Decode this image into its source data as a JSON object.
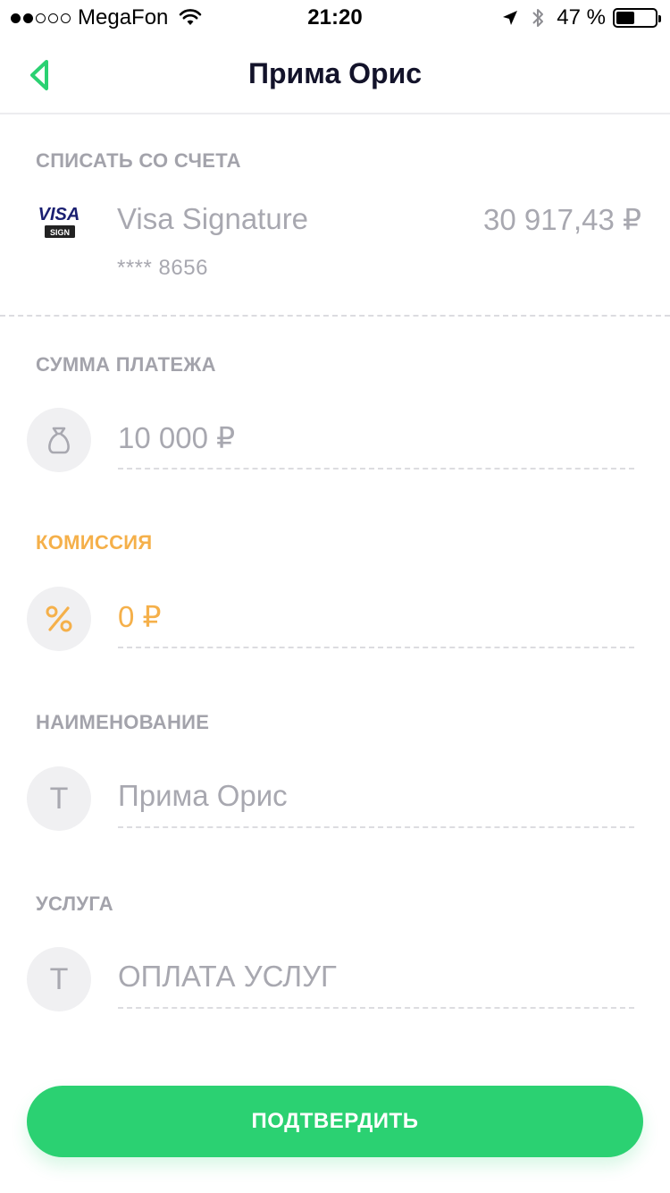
{
  "status_bar": {
    "carrier": "MegaFon",
    "time": "21:20",
    "battery_percent": "47 %",
    "battery_level": 0.47,
    "signal_bars_filled": 2,
    "signal_bars_total": 5
  },
  "header": {
    "title": "Прима Орис",
    "back_icon": "chevron-left-icon",
    "accent_color": "#2bd172"
  },
  "debit_account": {
    "label": "СПИСАТЬ СО СЧЕТА",
    "card_brand": "VISA",
    "card_tier_badge": "SIGN",
    "card_name": "Visa Signature",
    "balance": "30 917,43 ₽",
    "card_number": "**** 8656"
  },
  "payment_amount": {
    "label": "СУММА ПЛАТЕЖА",
    "icon": "money-bag-icon",
    "value": "10 000 ₽"
  },
  "commission": {
    "label": "КОМИССИЯ",
    "icon": "percent-icon",
    "value": "0 ₽",
    "color": "#f5b04a"
  },
  "name_field": {
    "label": "НАИМЕНОВАНИЕ",
    "icon": "text-icon",
    "icon_glyph": "T",
    "value": "Прима Орис"
  },
  "service_field": {
    "label": "УСЛУГА",
    "icon": "text-icon",
    "icon_glyph": "T",
    "value": "ОПЛАТА УСЛУГ"
  },
  "confirm_button": {
    "label": "ПОДТВЕРДИТЬ",
    "color": "#2bd172"
  }
}
